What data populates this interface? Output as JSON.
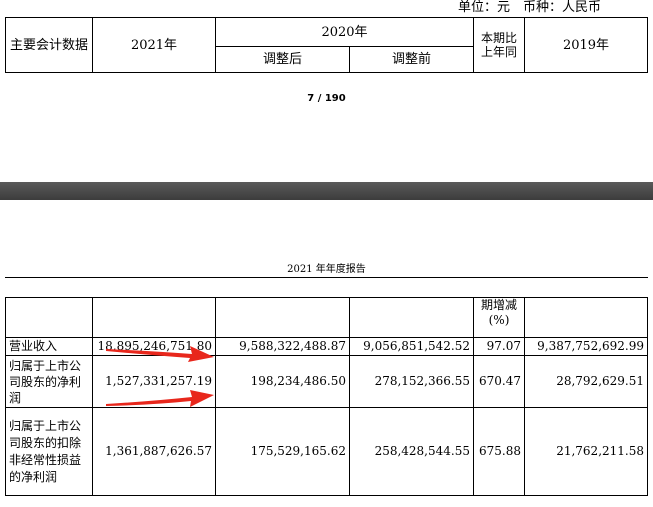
{
  "unit_line": "单位：元　币种：人民币",
  "page_number": "7 / 190",
  "report_header": "2021 年年度报告",
  "top_table": {
    "col_label": "主要会计数据",
    "col_2021": "2021年",
    "col_2020": "2020年",
    "col_adjusted_after": "调整后",
    "col_adjusted_before": "调整前",
    "col_yoy": "本期比上年同",
    "col_2019": "2019年"
  },
  "bottom_table": {
    "yoy_continued": "期增减(%)",
    "rows": [
      {
        "label": "营业收入",
        "v2021": "18,895,246,751.80",
        "v2020_after": "9,588,322,488.87",
        "v2020_before": "9,056,851,542.52",
        "yoy": "97.07",
        "v2019": "9,387,752,692.99"
      },
      {
        "label": "归属于上市公司股东的净利润",
        "v2021": "1,527,331,257.19",
        "v2020_after": "198,234,486.50",
        "v2020_before": "278,152,366.55",
        "yoy": "670.47",
        "v2019": "28,792,629.51"
      },
      {
        "label": "归属于上市公司股东的扣除非经常性损益的净利润",
        "v2021": "1,361,887,626.57",
        "v2020_after": "175,529,165.62",
        "v2020_before": "258,428,544.55",
        "yoy": "675.88",
        "v2019": "21,762,211.58"
      }
    ]
  },
  "colors": {
    "arrow": "#e8271c",
    "band": "#464646"
  }
}
